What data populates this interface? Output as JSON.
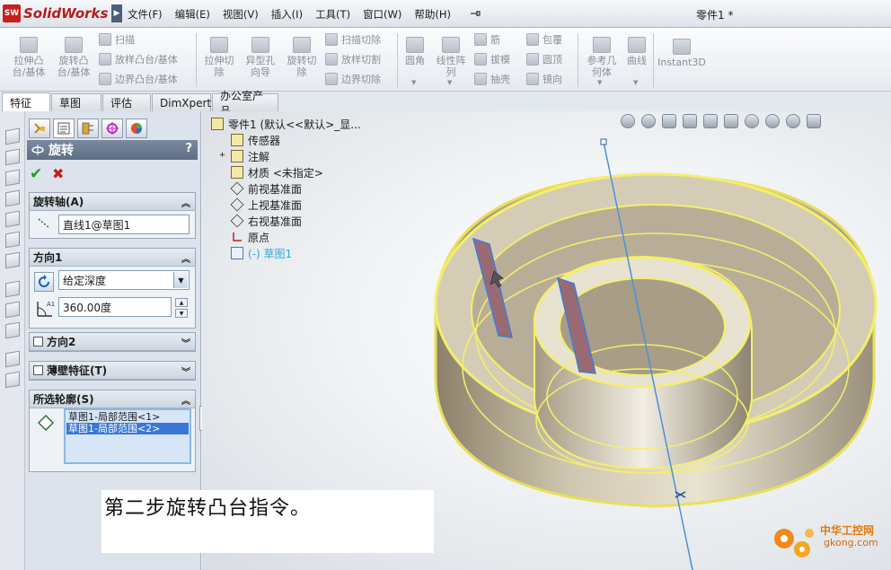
{
  "app": {
    "logo_mark": "SW",
    "logo_text": "SolidWorks",
    "document_title": "零件1 *"
  },
  "menu": [
    "文件(F)",
    "编辑(E)",
    "视图(V)",
    "插入(I)",
    "工具(T)",
    "窗口(W)",
    "帮助(H)"
  ],
  "command_manager": {
    "extrude_boss": "拉伸凸\n台/基体",
    "revolve_boss": "旋转凸\n台/基体",
    "sweep": "扫描",
    "loft": "放样凸台/基体",
    "boundary_boss": "边界凸台/基体",
    "extrude_cut": "拉伸切\n除",
    "hole_wizard": "异型孔\n向导",
    "revolve_cut": "旋转切\n除",
    "swept_cut": "扫描切除",
    "lofted_cut": "放样切割",
    "boundary_cut": "边界切除",
    "fillet": "圆角",
    "linear_pattern": "线性阵\n列",
    "rib": "筋",
    "draft": "拔模",
    "shell": "抽壳",
    "wrap": "包覆",
    "dome": "圆顶",
    "mirror": "镜向",
    "ref_geometry": "参考几\n何体",
    "curves": "曲线",
    "instant3d": "Instant3D"
  },
  "tabs": [
    "特征",
    "草图",
    "评估",
    "DimXpert",
    "办公室产品"
  ],
  "property_manager": {
    "title": "旋转",
    "help": "?",
    "axis_group": "旋转轴(A)",
    "axis_value": "直线1@草图1",
    "direction1_group": "方向1",
    "end_condition": "给定深度",
    "angle": "360.00度",
    "direction2_group": "方向2",
    "thin_feature_group": "薄壁特征(T)",
    "contours_group": "所选轮廓(S)",
    "contours": [
      "草图1-局部范围<1>",
      "草图1-局部范围<2>"
    ]
  },
  "feature_tree": {
    "root": "零件1  (默认<<默认>_显...",
    "items": [
      {
        "label": "传感器",
        "icon": "sensor-icon"
      },
      {
        "label": "注解",
        "icon": "annotation-icon"
      },
      {
        "label": "材质 <未指定>",
        "icon": "material-icon"
      },
      {
        "label": "前视基准面",
        "icon": "plane-icon"
      },
      {
        "label": "上视基准面",
        "icon": "plane-icon"
      },
      {
        "label": "右视基准面",
        "icon": "plane-icon"
      },
      {
        "label": "原点",
        "icon": "origin-icon"
      },
      {
        "label": "(-) 草图1",
        "icon": "sketch-icon"
      }
    ]
  },
  "caption": "第二步旋转凸台指令。",
  "watermark": {
    "brand": "中华工控网",
    "url": "gkong.com"
  },
  "colors": {
    "preview_yellow": "#f5ef6a",
    "axis_blue": "#4a90d9",
    "sketch_cyan": "#2ea9d6",
    "selection_blue": "#3b77d6"
  }
}
